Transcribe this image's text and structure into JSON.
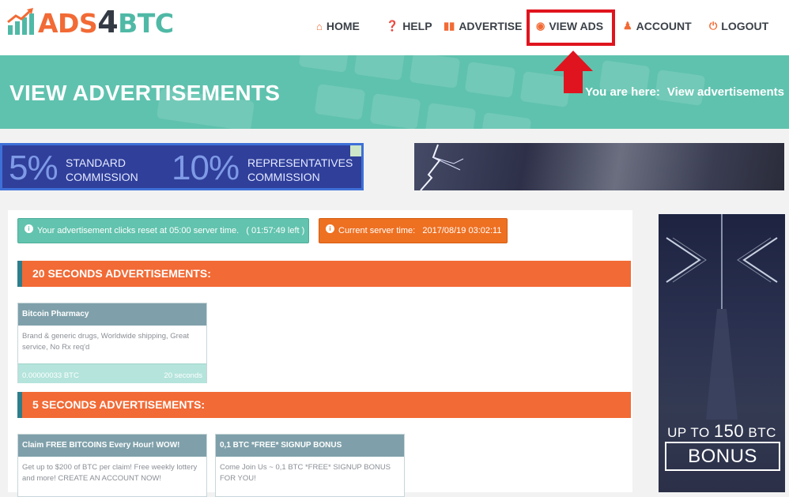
{
  "logo": {
    "ads": "ADS",
    "four": "4",
    "btc": "BTC"
  },
  "nav": {
    "home": "HOME",
    "help": "HELP",
    "advertise": "ADVERTISE",
    "view_ads": "VIEW ADS",
    "account": "ACCOUNT",
    "logout": "LOGOUT"
  },
  "banner": {
    "title": "VIEW ADVERTISEMENTS",
    "breadcrumb_label": "You are here:",
    "breadcrumb_current": "View advertisements"
  },
  "top_ad": {
    "standard_pct": "5%",
    "standard_line1": "STANDARD",
    "standard_line2": "COMMISSION",
    "rep_pct": "10%",
    "rep_line1": "REPRESENTATIVES",
    "rep_line2": "COMMISSION"
  },
  "alerts": {
    "reset": "Your advertisement clicks reset at 05:00 server time.   ( 01:57:49 left )",
    "server_time": "Current server time:   2017/08/19 03:02:11"
  },
  "sections": [
    {
      "title": "20 SECONDS ADVERTISEMENTS:",
      "ads": [
        {
          "title": "Bitcoin Pharmacy",
          "description": "Brand & generic drugs, Worldwide shipping, Great service, No Rx req'd",
          "reward": "0.00000033 BTC",
          "duration": "20 seconds"
        }
      ]
    },
    {
      "title": "5 SECONDS ADVERTISEMENTS:",
      "ads": [
        {
          "title": "Claim FREE BITCOINS Every Hour! WOW!",
          "description": "Get up to $200 of BTC per claim! Free weekly lottery and more! CREATE AN ACCOUNT NOW!"
        },
        {
          "title": "0,1 BTC *FREE* SIGNUP BONUS",
          "description": "Come Join Us ~ 0,1 BTC *FREE* SIGNUP BONUS FOR YOU!"
        }
      ]
    }
  ],
  "side_ad": {
    "up_to": "UP TO",
    "amount": "150",
    "unit": "BTC",
    "bonus": "BONUS"
  },
  "colors": {
    "orange": "#f26a35",
    "teal": "#5fc2ae",
    "highlight_red": "#e0141e"
  }
}
